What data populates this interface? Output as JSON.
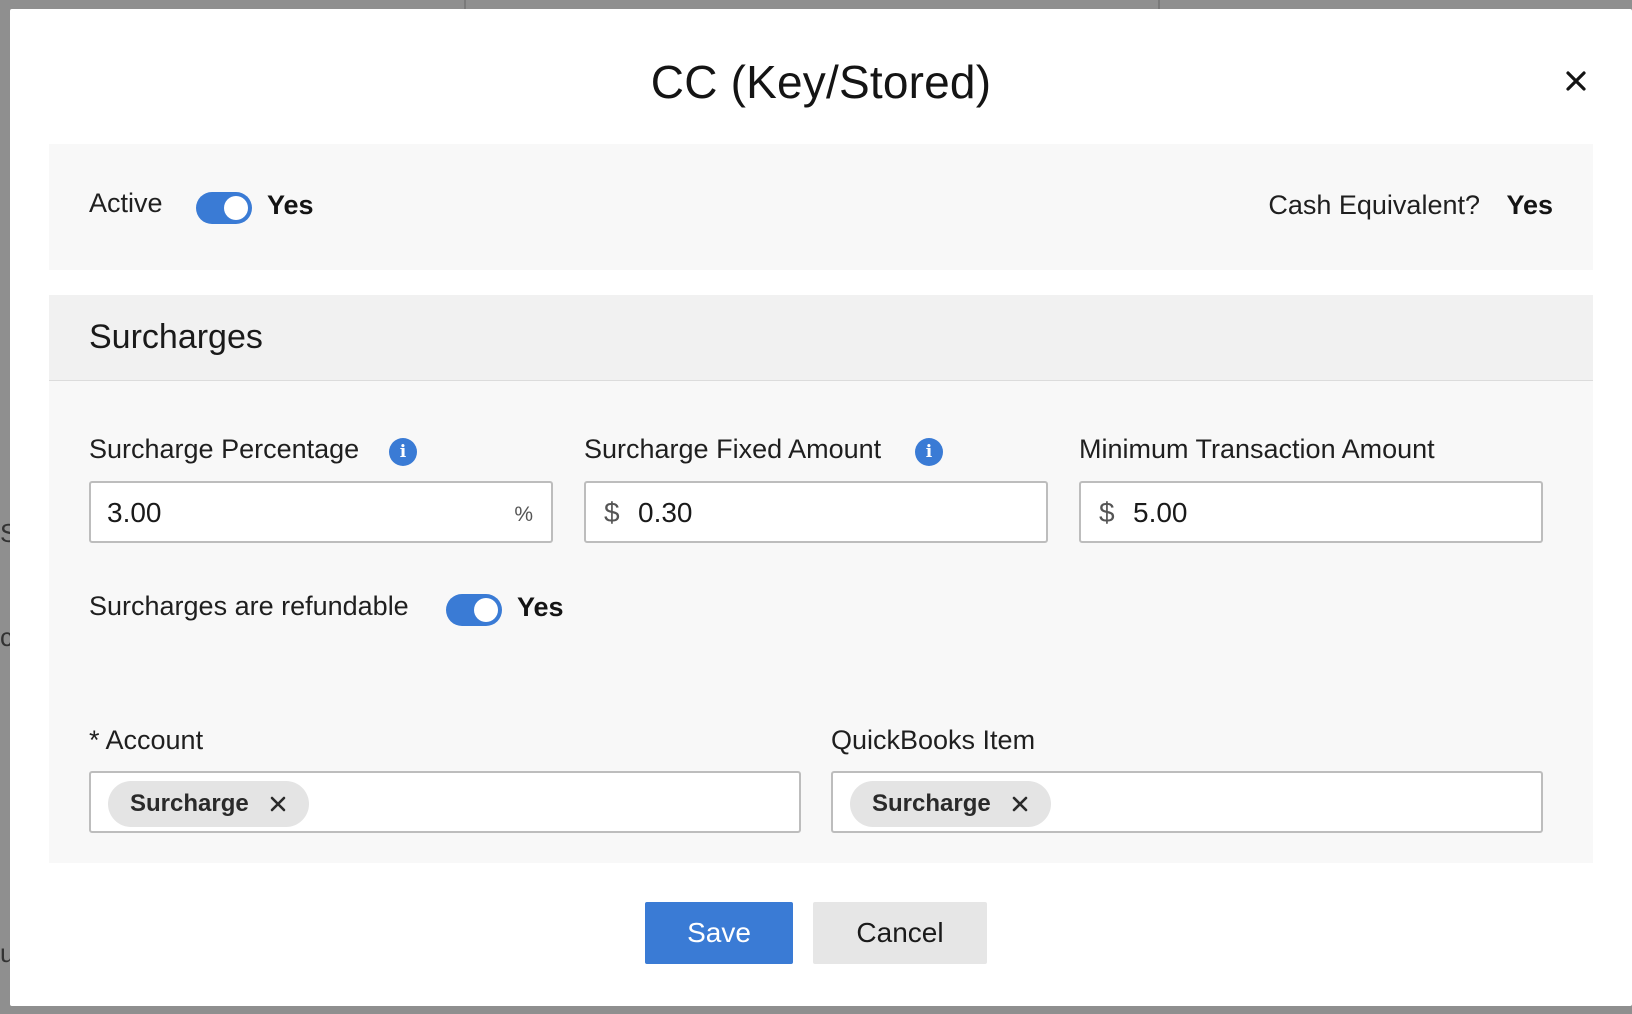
{
  "modal": {
    "title": "CC (Key/Stored)"
  },
  "status": {
    "active_label": "Active",
    "active_value": "Yes",
    "cash_equivalent_label": "Cash Equivalent?",
    "cash_equivalent_value": "Yes"
  },
  "surcharges": {
    "section_title": "Surcharges",
    "percentage": {
      "label": "Surcharge Percentage",
      "value": "3.00",
      "suffix": "%"
    },
    "fixed_amount": {
      "label": "Surcharge Fixed Amount",
      "currency": "$",
      "value": "0.30"
    },
    "minimum": {
      "label": "Minimum Transaction Amount",
      "currency": "$",
      "value": "5.00"
    },
    "refundable": {
      "label": "Surcharges are refundable",
      "value": "Yes"
    },
    "account": {
      "label": "* Account",
      "chip": "Surcharge"
    },
    "quickbooks": {
      "label": "QuickBooks Item",
      "chip": "Surcharge"
    }
  },
  "actions": {
    "save_label": "Save",
    "cancel_label": "Cancel"
  },
  "backdrop_fragments": [
    "S",
    "c",
    "u"
  ],
  "colors": {
    "accent": "#3a7bd5",
    "panel_bg": "#f8f8f8",
    "chip_bg": "#e4e4e4",
    "cancel_bg": "#e6e6e6"
  },
  "icons": {
    "close": "close-icon",
    "info": "info-icon",
    "chip_remove": "chip-remove-icon"
  }
}
